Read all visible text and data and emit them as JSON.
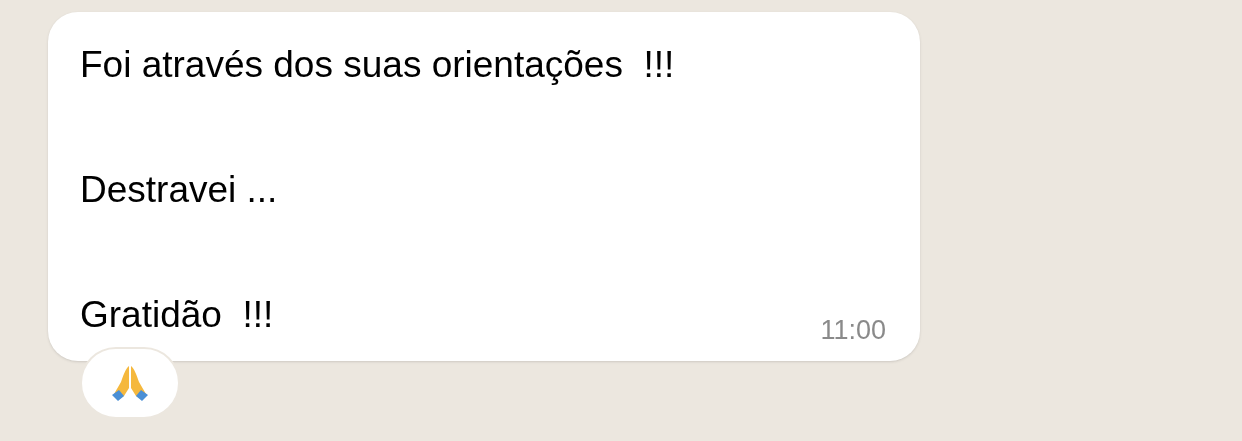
{
  "message": {
    "paragraphs": [
      "Foi através dos suas orientações  !!!",
      "Destravei ...",
      "Gratidão  !!!"
    ],
    "time": "11:00"
  },
  "reaction": {
    "kind": "praying-hands"
  }
}
